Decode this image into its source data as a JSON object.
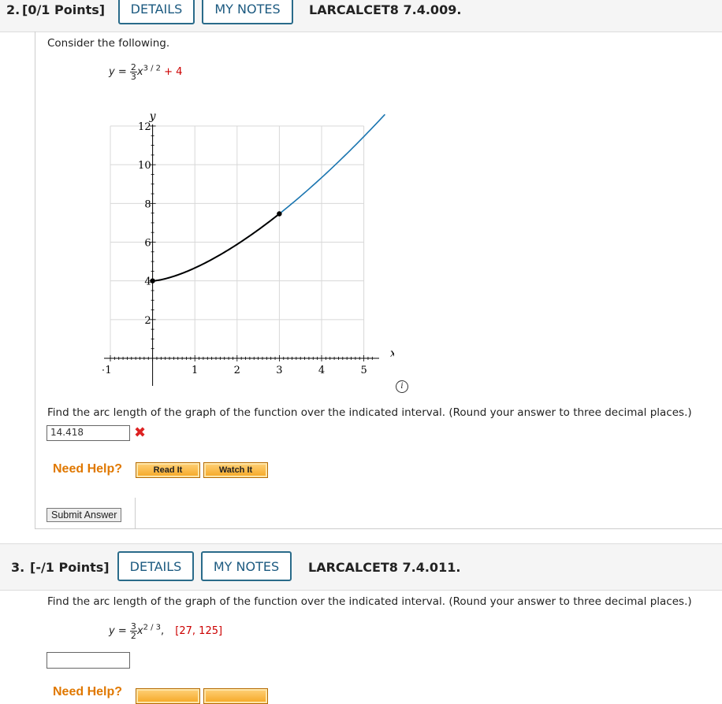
{
  "q2": {
    "number": "2.",
    "points": "[0/1 Points]",
    "details_label": "DETAILS",
    "notes_label": "MY NOTES",
    "code": "LARCALCET8 7.4.009.",
    "prompt": "Consider the following.",
    "eq_lhs": "y =",
    "eq_frac_num": "2",
    "eq_frac_den": "3",
    "eq_var": "x",
    "eq_exp": "3 / 2",
    "eq_plus": "+ 4",
    "instruction": "Find the arc length of the graph of the function over the indicated interval. (Round your answer to three decimal places.)",
    "answer_value": "14.418",
    "need_help": "Need Help?",
    "read_it": "Read It",
    "watch_it": "Watch It",
    "submit": "Submit Answer"
  },
  "q3": {
    "number": "3.",
    "points": "[-/1 Points]",
    "details_label": "DETAILS",
    "notes_label": "MY NOTES",
    "code": "LARCALCET8 7.4.011.",
    "instruction": "Find the arc length of the graph of the function over the indicated interval. (Round your answer to three decimal places.)",
    "eq_lhs": "y =",
    "eq_frac_num": "3",
    "eq_frac_den": "2",
    "eq_var": "x",
    "eq_exp": "2 / 3",
    "eq_comma": ",",
    "interval": "[27, 125]",
    "answer_value": "",
    "need_help": "Need Help?"
  },
  "chart_data": {
    "type": "line",
    "title": "",
    "xlabel": "x",
    "ylabel": "y",
    "xlim": [
      -1,
      5
    ],
    "ylim": [
      0,
      12
    ],
    "x_ticks": [
      "-1",
      "1",
      "2",
      "3",
      "4",
      "5"
    ],
    "y_ticks": [
      "2",
      "4",
      "6",
      "8",
      "10",
      "12"
    ],
    "grid": true,
    "series": [
      {
        "color": "#1a75b0",
        "x": [
          0,
          1,
          2,
          3,
          4,
          5.5
        ],
        "y": [
          4,
          4.667,
          5.886,
          7.464,
          9.333,
          12.6
        ]
      },
      {
        "color": "#000000",
        "x": [
          0,
          1,
          2,
          3
        ],
        "y": [
          4,
          4.667,
          5.886,
          7.464
        ]
      }
    ],
    "points": [
      {
        "x": 0,
        "y": 4
      },
      {
        "x": 3,
        "y": 7.464
      }
    ]
  },
  "colors": {
    "accent": "#1c5a80",
    "error": "#d22222",
    "help": "#e07800"
  }
}
